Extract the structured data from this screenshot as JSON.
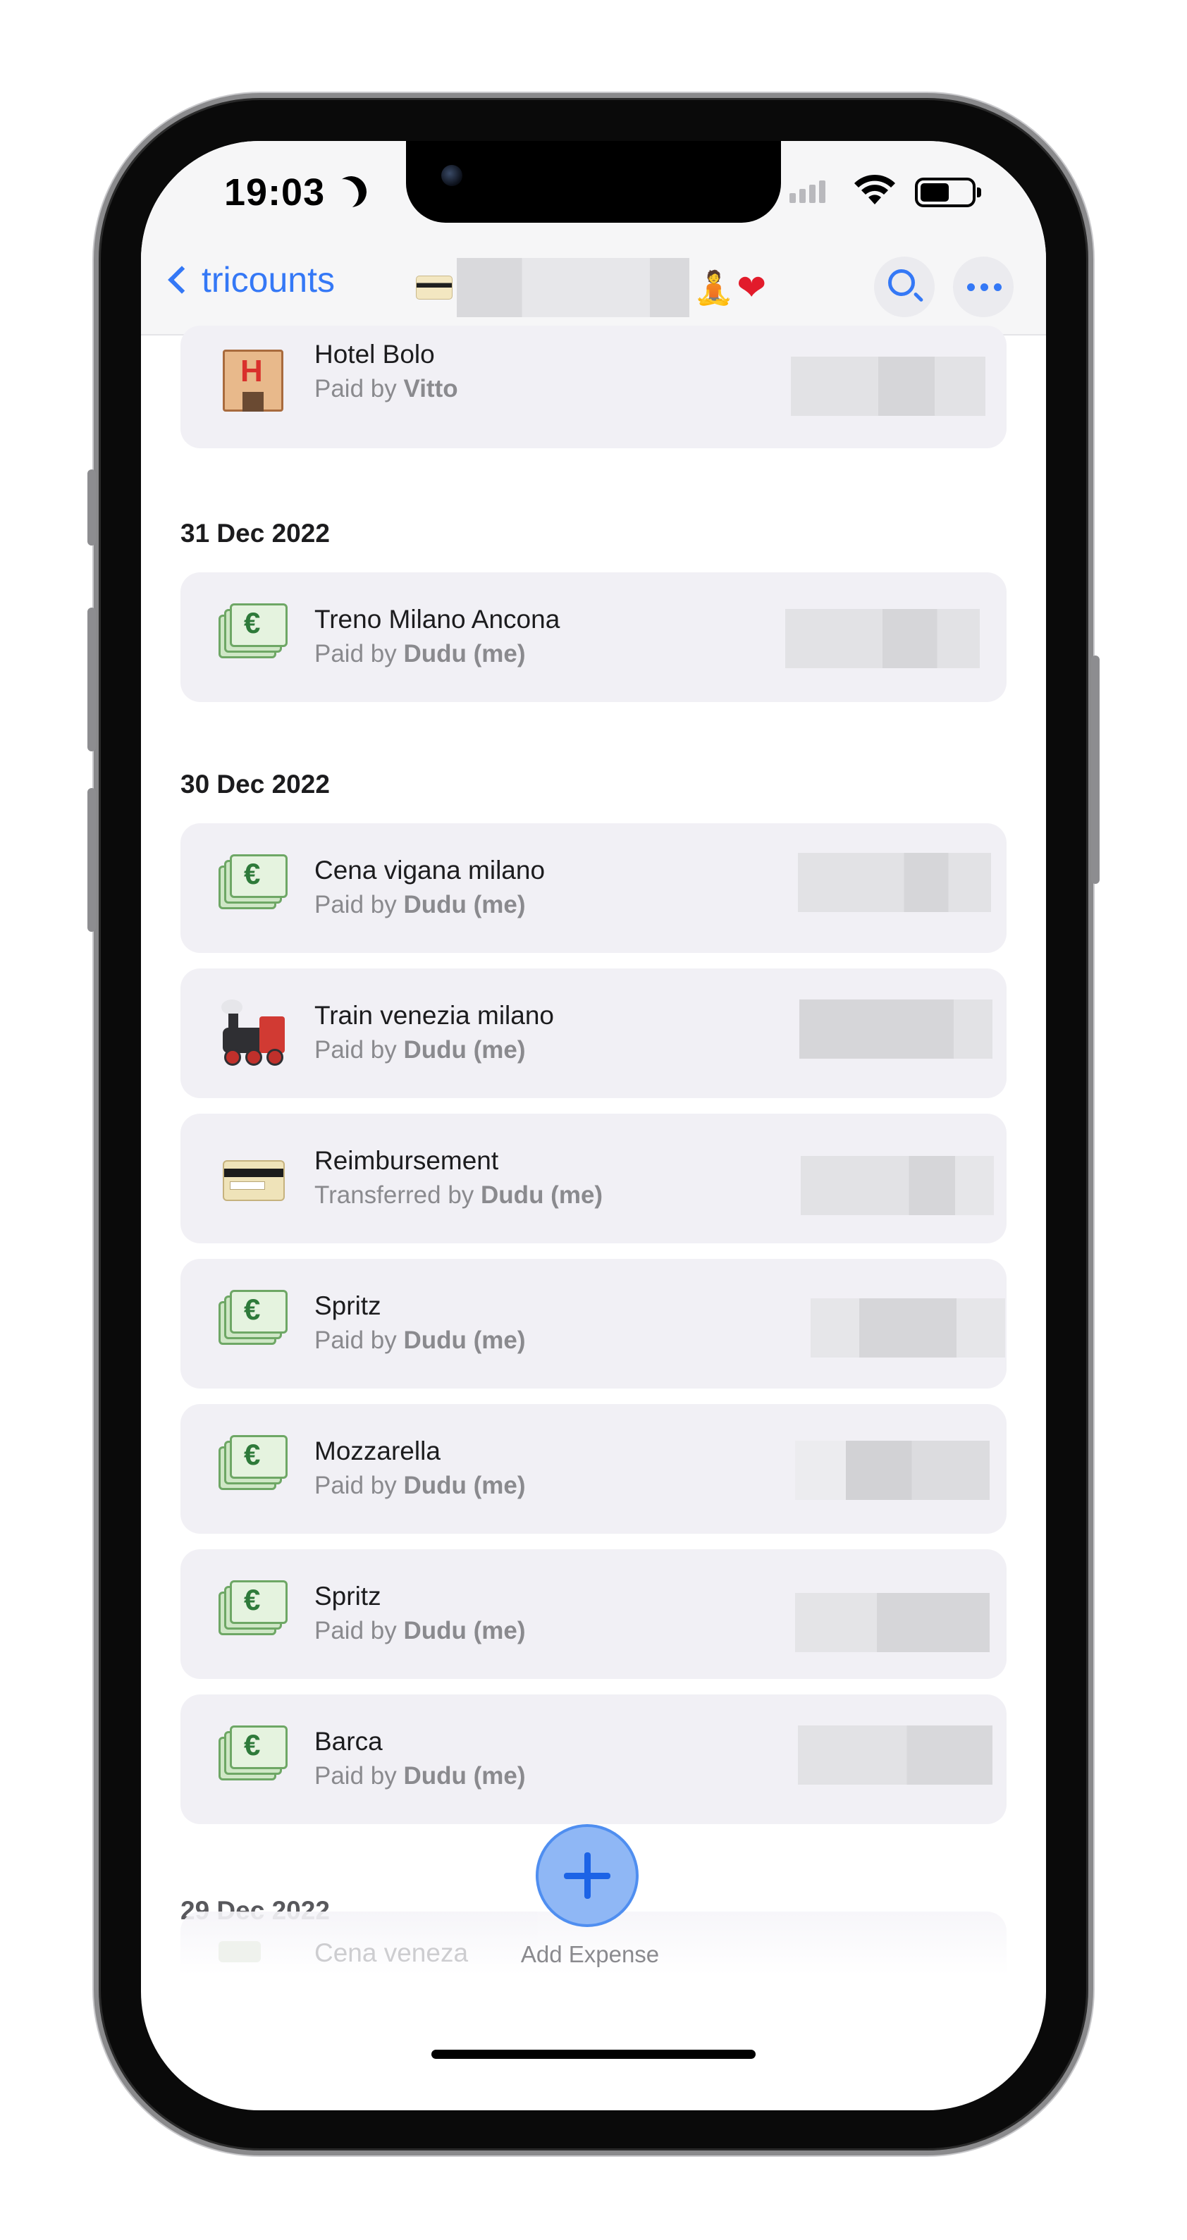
{
  "status_bar": {
    "time": "19:03"
  },
  "nav": {
    "back_label": "tricounts",
    "title_emoji": "🧘",
    "title_heart": "❤"
  },
  "sections": [
    {
      "date": "",
      "items": [
        {
          "title": "Hotel Bolo",
          "prefix": "Paid by",
          "person": "Vitto",
          "icon": "hotel-icon"
        }
      ]
    },
    {
      "date": "31 Dec 2022",
      "items": [
        {
          "title": "Treno Milano Ancona",
          "prefix": "Paid by",
          "person": "Dudu (me)",
          "icon": "euro-banknote-icon"
        }
      ]
    },
    {
      "date": "30 Dec 2022",
      "items": [
        {
          "title": "Cena vigana milano",
          "prefix": "Paid by",
          "person": "Dudu (me)",
          "icon": "euro-banknote-icon"
        },
        {
          "title": "Train venezia milano",
          "prefix": "Paid by",
          "person": "Dudu (me)",
          "icon": "locomotive-icon"
        },
        {
          "title": "Reimbursement",
          "prefix": "Transferred by",
          "person": "Dudu (me)",
          "icon": "credit-card-icon"
        },
        {
          "title": "Spritz",
          "prefix": "Paid by",
          "person": "Dudu (me)",
          "icon": "euro-banknote-icon"
        },
        {
          "title": "Mozzarella",
          "prefix": "Paid by",
          "person": "Dudu (me)",
          "icon": "euro-banknote-icon"
        },
        {
          "title": "Spritz",
          "prefix": "Paid by",
          "person": "Dudu (me)",
          "icon": "euro-banknote-icon"
        },
        {
          "title": "Barca",
          "prefix": "Paid by",
          "person": "Dudu (me)",
          "icon": "euro-banknote-icon"
        }
      ]
    },
    {
      "date": "29 Dec 2022",
      "items": [
        {
          "title": "Cena veneza",
          "icon": "euro-banknote-icon"
        }
      ]
    }
  ],
  "fab": {
    "label": "Add Expense"
  },
  "colors": {
    "accent": "#3478f6",
    "card_bg": "#f1f0f5",
    "secondary_text": "#8a8a8e"
  }
}
